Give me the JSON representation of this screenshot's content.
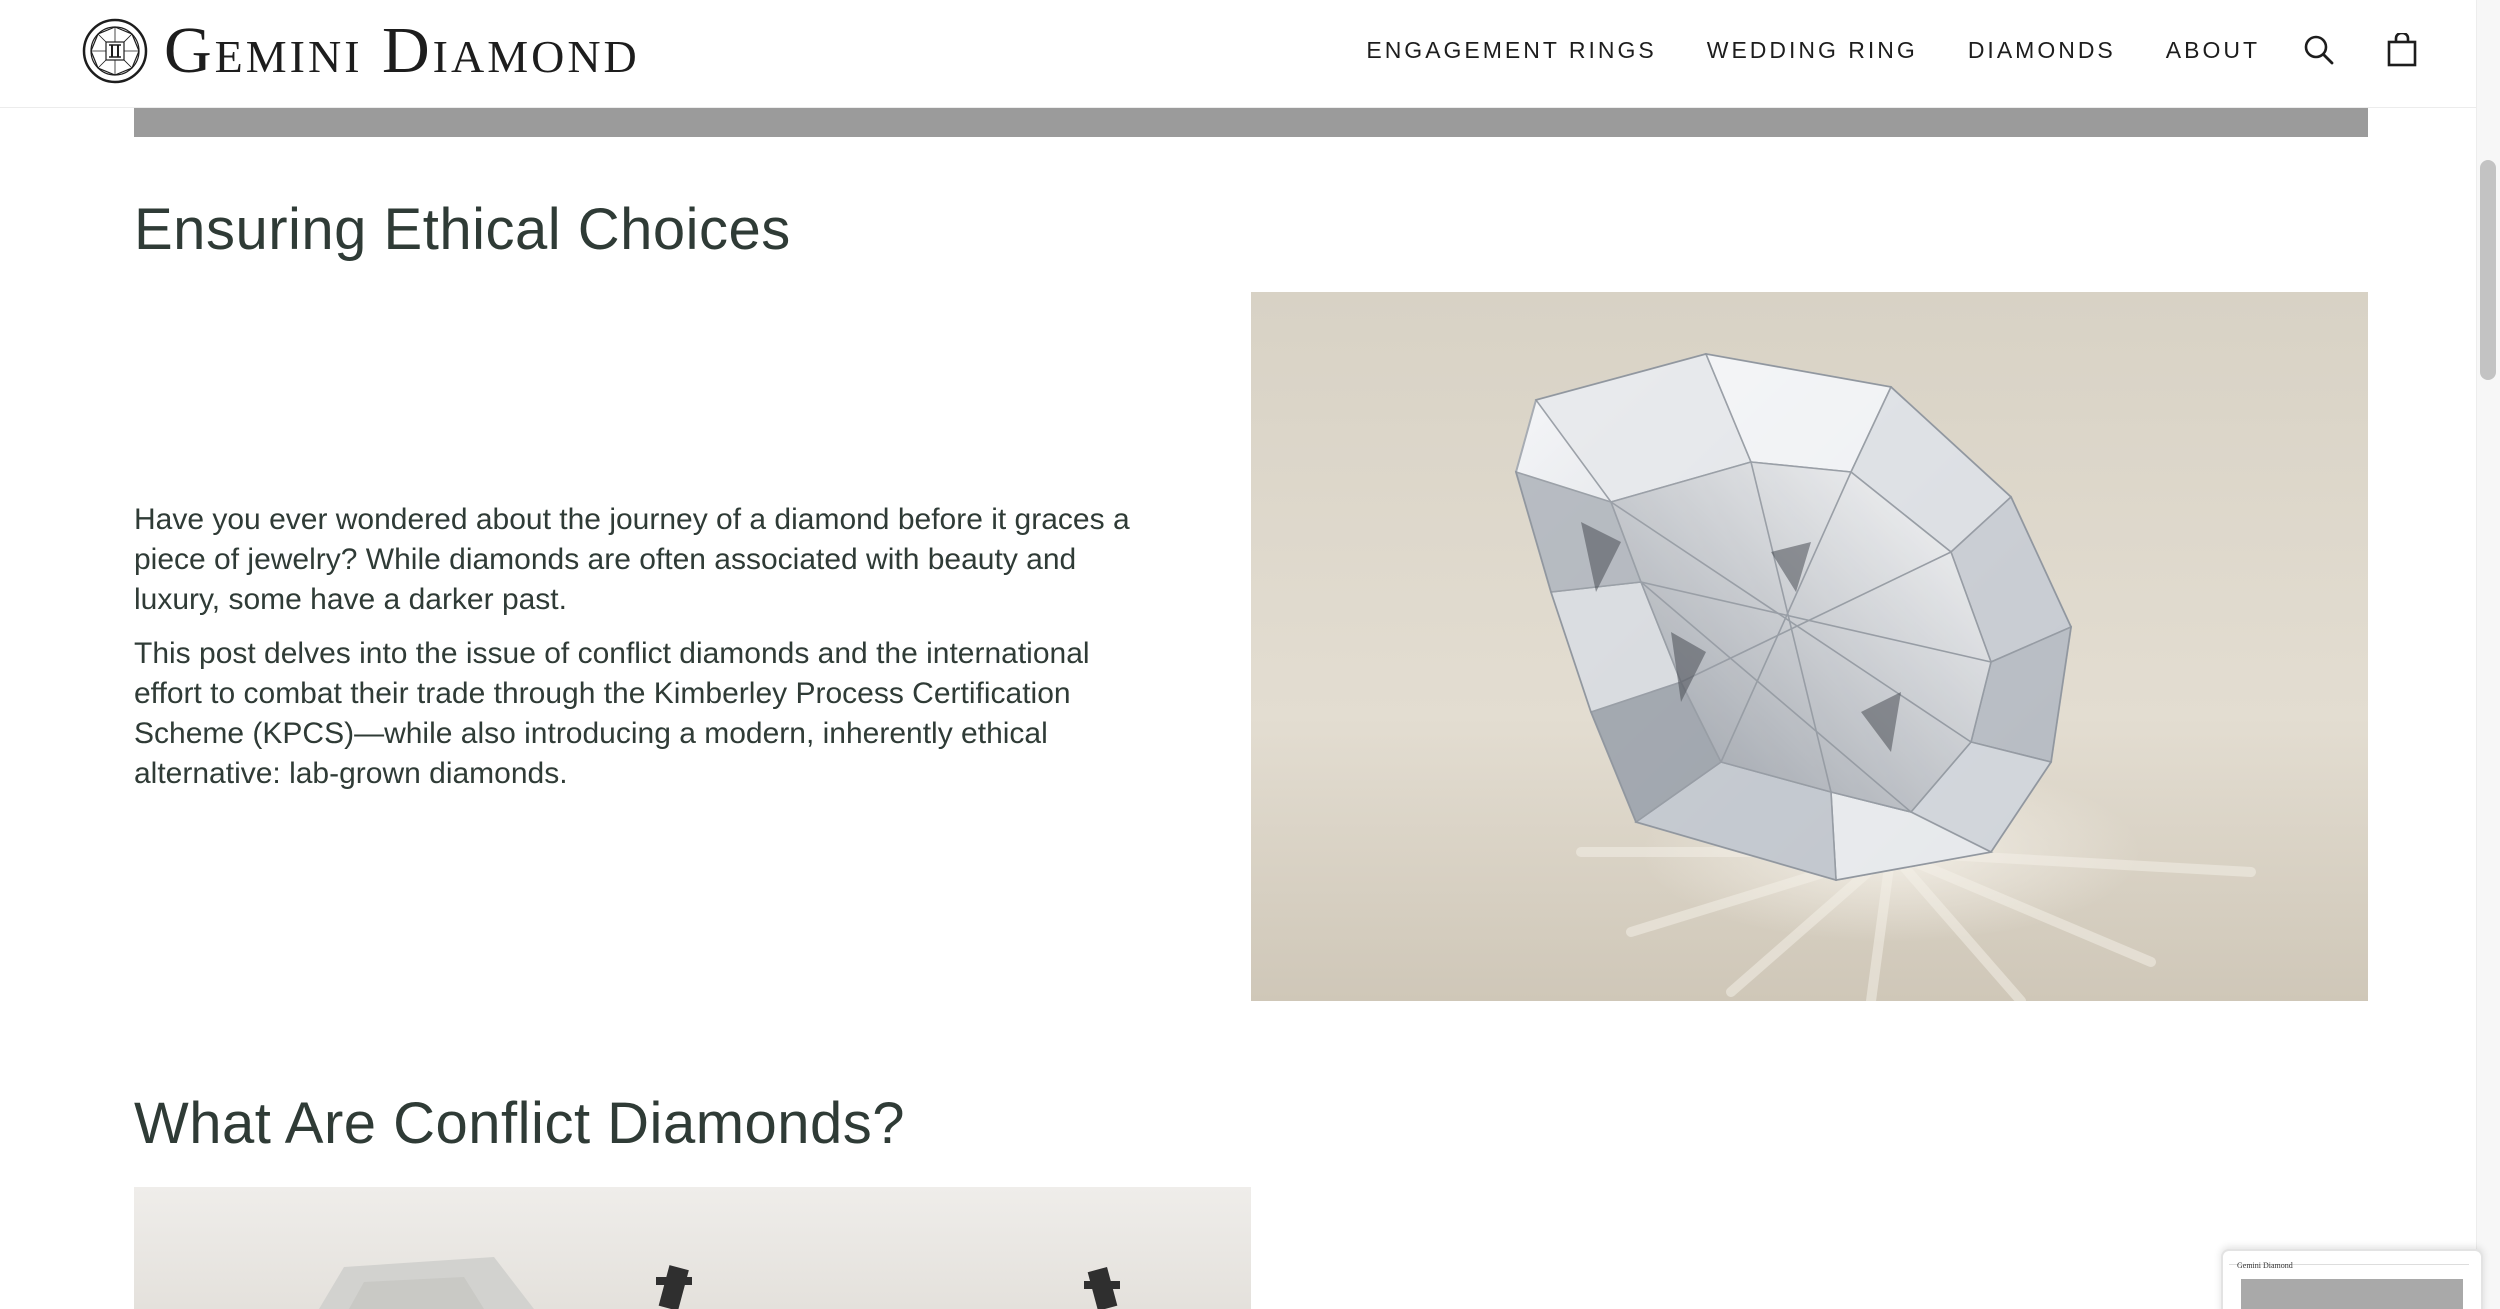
{
  "header": {
    "logo_text": "Gemini Diamond",
    "nav": [
      {
        "label": "ENGAGEMENT RINGS"
      },
      {
        "label": "WEDDING RING"
      },
      {
        "label": "DIAMONDS"
      },
      {
        "label": "ABOUT"
      }
    ],
    "icons": {
      "search": "search-icon",
      "cart": "shopping-bag-icon",
      "logo": "diamond-logo-icon"
    }
  },
  "article": {
    "heading_ethical": "Ensuring Ethical Choices",
    "intro_paragraphs": [
      "Have you ever wondered about the journey of a diamond before it graces a piece of jewelry? While diamonds are often associated with beauty and luxury, some have a darker past.",
      "This post delves into the issue of conflict diamonds and the international effort to combat their trade through the Kimberley Process Certification Scheme (KPCS)—while also introducing a modern, inherently ethical alternative: lab-grown diamonds."
    ],
    "heading_conflict": "What Are Conflict Diamonds?"
  },
  "mini_preview": {
    "logo_text": "Gemini Diamond"
  },
  "colors": {
    "heading": "#2f3b36",
    "band": "#9b9b9b",
    "diamond_bg": "#dcd5c8"
  }
}
